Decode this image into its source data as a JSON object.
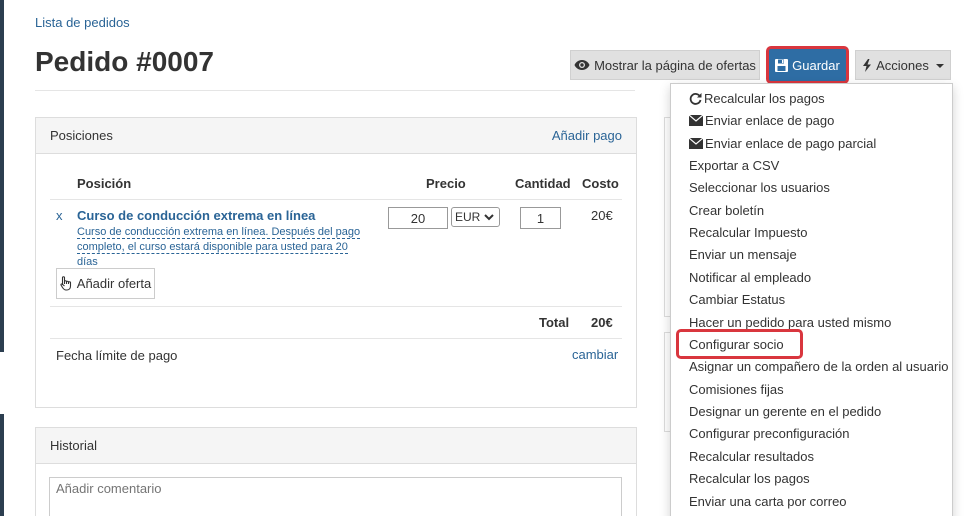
{
  "breadcrumb": "Lista de pedidos",
  "page_title": "Pedido #0007",
  "toolbar": {
    "show_offers_label": "Mostrar la página de ofertas",
    "save_label": "Guardar",
    "actions_label": "Acciones"
  },
  "positions_panel": {
    "title": "Posiciones",
    "add_payment": "Añadir pago",
    "columns": [
      "Posición",
      "Precio",
      "Cantidad",
      "Costo"
    ],
    "item": {
      "remove": "x",
      "name": "Curso de conducción extrema en línea",
      "description": "Curso de conducción extrema en línea. Después del pago completo, el curso estará disponible para usted para 20 días",
      "price": "20",
      "currency": "EUR",
      "quantity": "1",
      "cost": "20€"
    },
    "add_offer": "Añadir oferta",
    "total_label": "Total",
    "total_value": "20€",
    "due_date_label": "Fecha límite de pago",
    "due_date_change": "cambiar"
  },
  "history_panel": {
    "title": "Historial",
    "comment_placeholder": "Añadir comentario"
  },
  "actions_menu": [
    "Recalcular los pagos",
    "Enviar enlace de pago",
    "Enviar enlace de pago parcial",
    "Exportar a CSV",
    "Seleccionar los usuarios",
    "Crear boletín",
    "Recalcular Impuesto",
    "Enviar un mensaje",
    "Notificar al empleado",
    "Cambiar Estatus",
    "Hacer un pedido para usted mismo",
    "Configurar socio",
    "Asignar un compañero de la orden al usuario",
    "Comisiones fijas",
    "Designar un gerente en el pedido",
    "Configurar preconfiguración",
    "Recalcular resultados",
    "Recalcular los pagos",
    "Enviar una carta por correo"
  ],
  "colors": {
    "primary": "#2e6da4",
    "highlight": "#d9363e",
    "link": "#2a6496"
  },
  "icons": {
    "show_offers": "eye-icon",
    "save": "floppy-disk-icon",
    "actions": "lightning-icon",
    "menu_recalc": "refresh-icon",
    "menu_send": "envelope-icon",
    "add_offer": "hand-pointer-icon"
  }
}
